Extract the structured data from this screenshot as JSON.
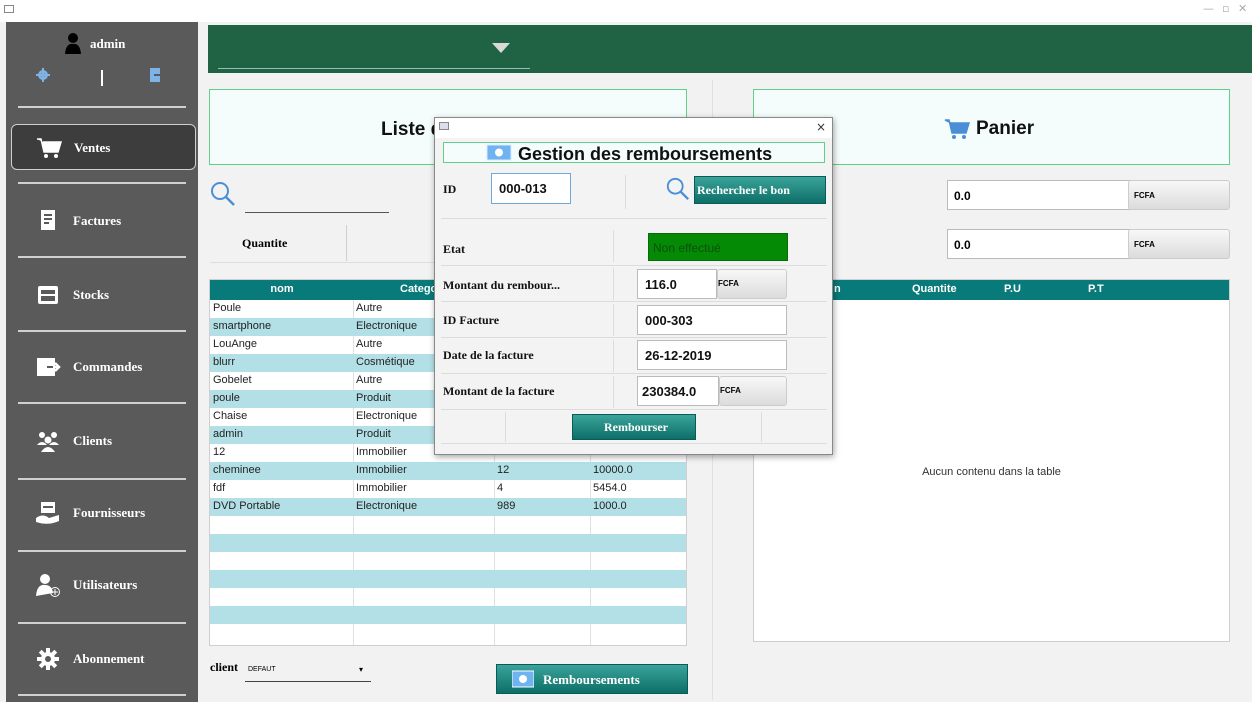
{
  "window": {
    "minimize": "—",
    "maximize": "▫",
    "close": "✕"
  },
  "user": {
    "name": "admin"
  },
  "sidebar": {
    "items": [
      {
        "label": "Ventes",
        "icon": "cart-icon",
        "active": true
      },
      {
        "label": "Factures",
        "icon": "invoice-icon"
      },
      {
        "label": "Stocks",
        "icon": "stock-icon"
      },
      {
        "label": "Commandes",
        "icon": "order-icon"
      },
      {
        "label": "Clients",
        "icon": "clients-icon"
      },
      {
        "label": "Fournisseurs",
        "icon": "supplier-icon"
      },
      {
        "label": "Utilisateurs",
        "icon": "add-user-icon"
      },
      {
        "label": "Abonnement",
        "icon": "gear-icon"
      }
    ]
  },
  "left": {
    "header_title": "Liste d",
    "quantity_label": "Quantite",
    "columns": [
      "nom",
      "Catego"
    ],
    "rows": [
      {
        "nom": "Poule",
        "cat": "Autre",
        "qty": "",
        "price": ""
      },
      {
        "nom": "smartphone",
        "cat": "Electronique",
        "qty": "",
        "price": ""
      },
      {
        "nom": "LouAnge",
        "cat": "Autre",
        "qty": "",
        "price": ""
      },
      {
        "nom": "blurr",
        "cat": "Cosmétique",
        "qty": "",
        "price": ""
      },
      {
        "nom": "Gobelet",
        "cat": "Autre",
        "qty": "",
        "price": ""
      },
      {
        "nom": "poule",
        "cat": "Produit",
        "qty": "",
        "price": ""
      },
      {
        "nom": "Chaise",
        "cat": "Electronique",
        "qty": "",
        "price": ""
      },
      {
        "nom": "admin",
        "cat": "Produit",
        "qty": "",
        "price": ""
      },
      {
        "nom": "12",
        "cat": "Immobilier",
        "qty": "",
        "price": ""
      },
      {
        "nom": "cheminee",
        "cat": "Immobilier",
        "qty": "12",
        "price": "10000.0"
      },
      {
        "nom": "fdf",
        "cat": "Immobilier",
        "qty": "4",
        "price": "5454.0"
      },
      {
        "nom": "DVD Portable",
        "cat": "Electronique",
        "qty": "989",
        "price": "1000.0"
      }
    ],
    "client_label": "client",
    "client_value": "DEFAUT",
    "remboursements_button": "Remboursements"
  },
  "right": {
    "header_title": "Panier",
    "total1": "0.0",
    "total2": "0.0",
    "unit": "FCFA",
    "columns": [
      "n",
      "Quantite",
      "P.U",
      "P.T"
    ],
    "empty_text": "Aucun contenu dans la table"
  },
  "dialog": {
    "title": "Gestion des remboursements",
    "close": "×",
    "id_label": "ID",
    "id_value": "000-013",
    "search_button": "Rechercher le bon",
    "etat_label": "Etat",
    "etat_value": "Non effectué",
    "montant_label": "Montant du rembour...",
    "montant_value": "116.0",
    "unit": "FCFA",
    "id_facture_label": "ID Facture",
    "id_facture_value": "000-303",
    "date_label": "Date de la facture",
    "date_value": "26-12-2019",
    "montant_facture_label": "Montant de la facture",
    "montant_facture_value": "230384.0",
    "rembourser_button": "Rembourser",
    "colors": {
      "etat_bg": "#048a04",
      "etat_text": "#0d4f0d"
    }
  },
  "colors": {
    "sidebar": "#5a5a5a",
    "topbar": "#1f6244",
    "table_header": "#097a7a",
    "row_alt": "#b2e0e6",
    "header_border": "#5fd08a"
  }
}
